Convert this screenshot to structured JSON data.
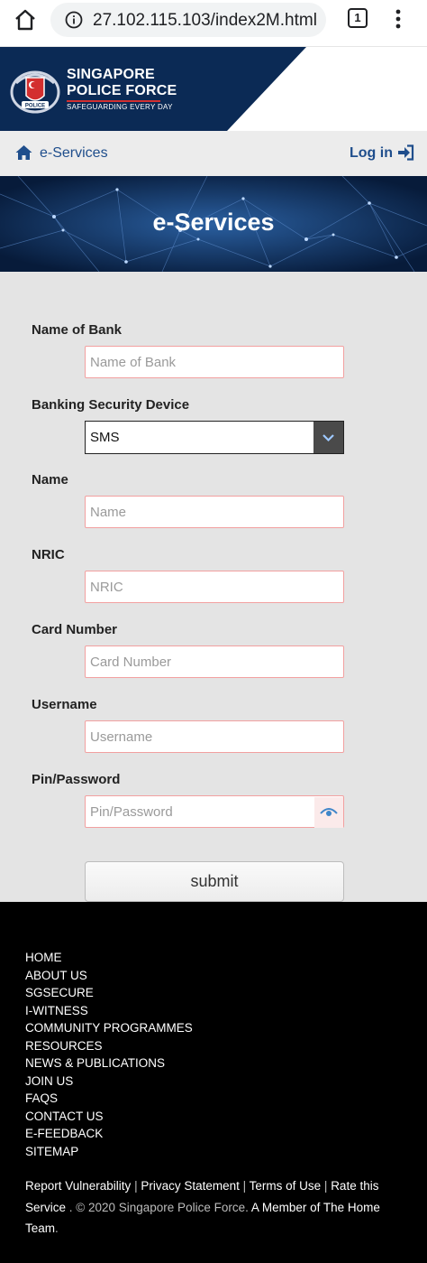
{
  "browser": {
    "url": "27.102.115.103/index2M.html",
    "tab_count": "1"
  },
  "header": {
    "org_name_line1": "SINGAPORE",
    "org_name_line2": "POLICE FORCE",
    "tagline": "SAFEGUARDING EVERY DAY",
    "crest_text": "POLICE"
  },
  "nav": {
    "eservices_label": "e-Services",
    "login_label": "Log in"
  },
  "hero": {
    "title": "e-Services"
  },
  "form": {
    "bank": {
      "label": "Name of Bank",
      "placeholder": "Name of Bank",
      "value": ""
    },
    "device": {
      "label": "Banking Security Device",
      "selected": "SMS"
    },
    "name": {
      "label": "Name",
      "placeholder": "Name",
      "value": ""
    },
    "nric": {
      "label": "NRIC",
      "placeholder": "NRIC",
      "value": ""
    },
    "card": {
      "label": "Card Number",
      "placeholder": "Card Number",
      "value": ""
    },
    "username": {
      "label": "Username",
      "placeholder": "Username",
      "value": ""
    },
    "password": {
      "label": "Pin/Password",
      "placeholder": "Pin/Password",
      "value": ""
    },
    "submit_label": "submit"
  },
  "footer": {
    "links": [
      "HOME",
      "ABOUT US",
      "SGSECURE",
      "I-WITNESS",
      "COMMUNITY PROGRAMMES",
      "RESOURCES",
      "NEWS & PUBLICATIONS",
      "JOIN US",
      "FAQS",
      "CONTACT US",
      "E-FEEDBACK",
      "SITEMAP"
    ],
    "report_vulnerability": "Report Vulnerability",
    "privacy_statement": "Privacy Statement",
    "terms_of_use": "Terms of Use",
    "rate_this_service": "Rate this Service",
    "copyright": ". © 2020 Singapore Police Force.",
    "member_link": "A Member of The Home Team",
    "end_period": "."
  },
  "colors": {
    "navy": "#0b2a55",
    "link_blue": "#1f4e8c",
    "input_border": "#f2a0a0",
    "crest_red": "#d32f2f"
  }
}
